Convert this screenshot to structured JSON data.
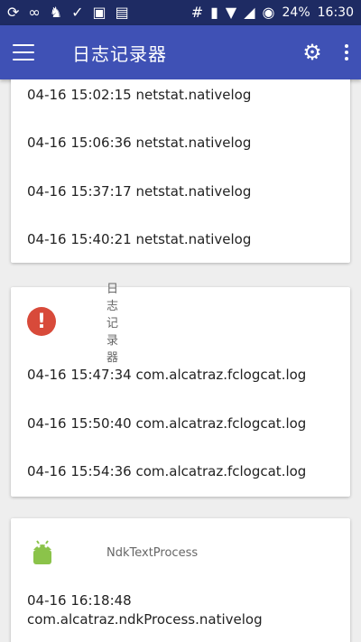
{
  "status": {
    "battery": "24%",
    "time": "16:30",
    "left_icons": [
      "sync-icon",
      "infinity-icon",
      "avatar-icon",
      "check-icon",
      "image-icon",
      "file-icon"
    ],
    "right_icons": [
      "hash-icon",
      "vibrate-icon",
      "wifi-icon",
      "signal-icon",
      "battery-saver-icon"
    ]
  },
  "appbar": {
    "title": "日志记录器",
    "menu_icon": "hamburger-icon",
    "settings_icon": "gear-icon",
    "more_icon": "more-icon"
  },
  "cards": [
    {
      "rows": [
        "04-16 15:02:15 netstat.nativelog",
        "04-16 15:06:36 netstat.nativelog",
        "04-16 15:37:17 netstat.nativelog",
        "04-16 15:40:21 netstat.nativelog"
      ]
    },
    {
      "header": "日志记录器",
      "icon": "warning-icon",
      "rows": [
        "04-16 15:47:34 com.alcatraz.fclogcat.log",
        "04-16 15:50:40 com.alcatraz.fclogcat.log",
        "04-16 15:54:36 com.alcatraz.fclogcat.log"
      ]
    },
    {
      "header": "NdkTextProcess",
      "icon": "android-icon",
      "rows": [
        "04-16 16:18:48",
        "com.alcatraz.ndkProcess.nativelog"
      ]
    }
  ],
  "colors": {
    "statusbar": "#1e2b63",
    "appbar": "#3f51b5",
    "warning": "#d84a3a",
    "android": "#8bc34a"
  }
}
